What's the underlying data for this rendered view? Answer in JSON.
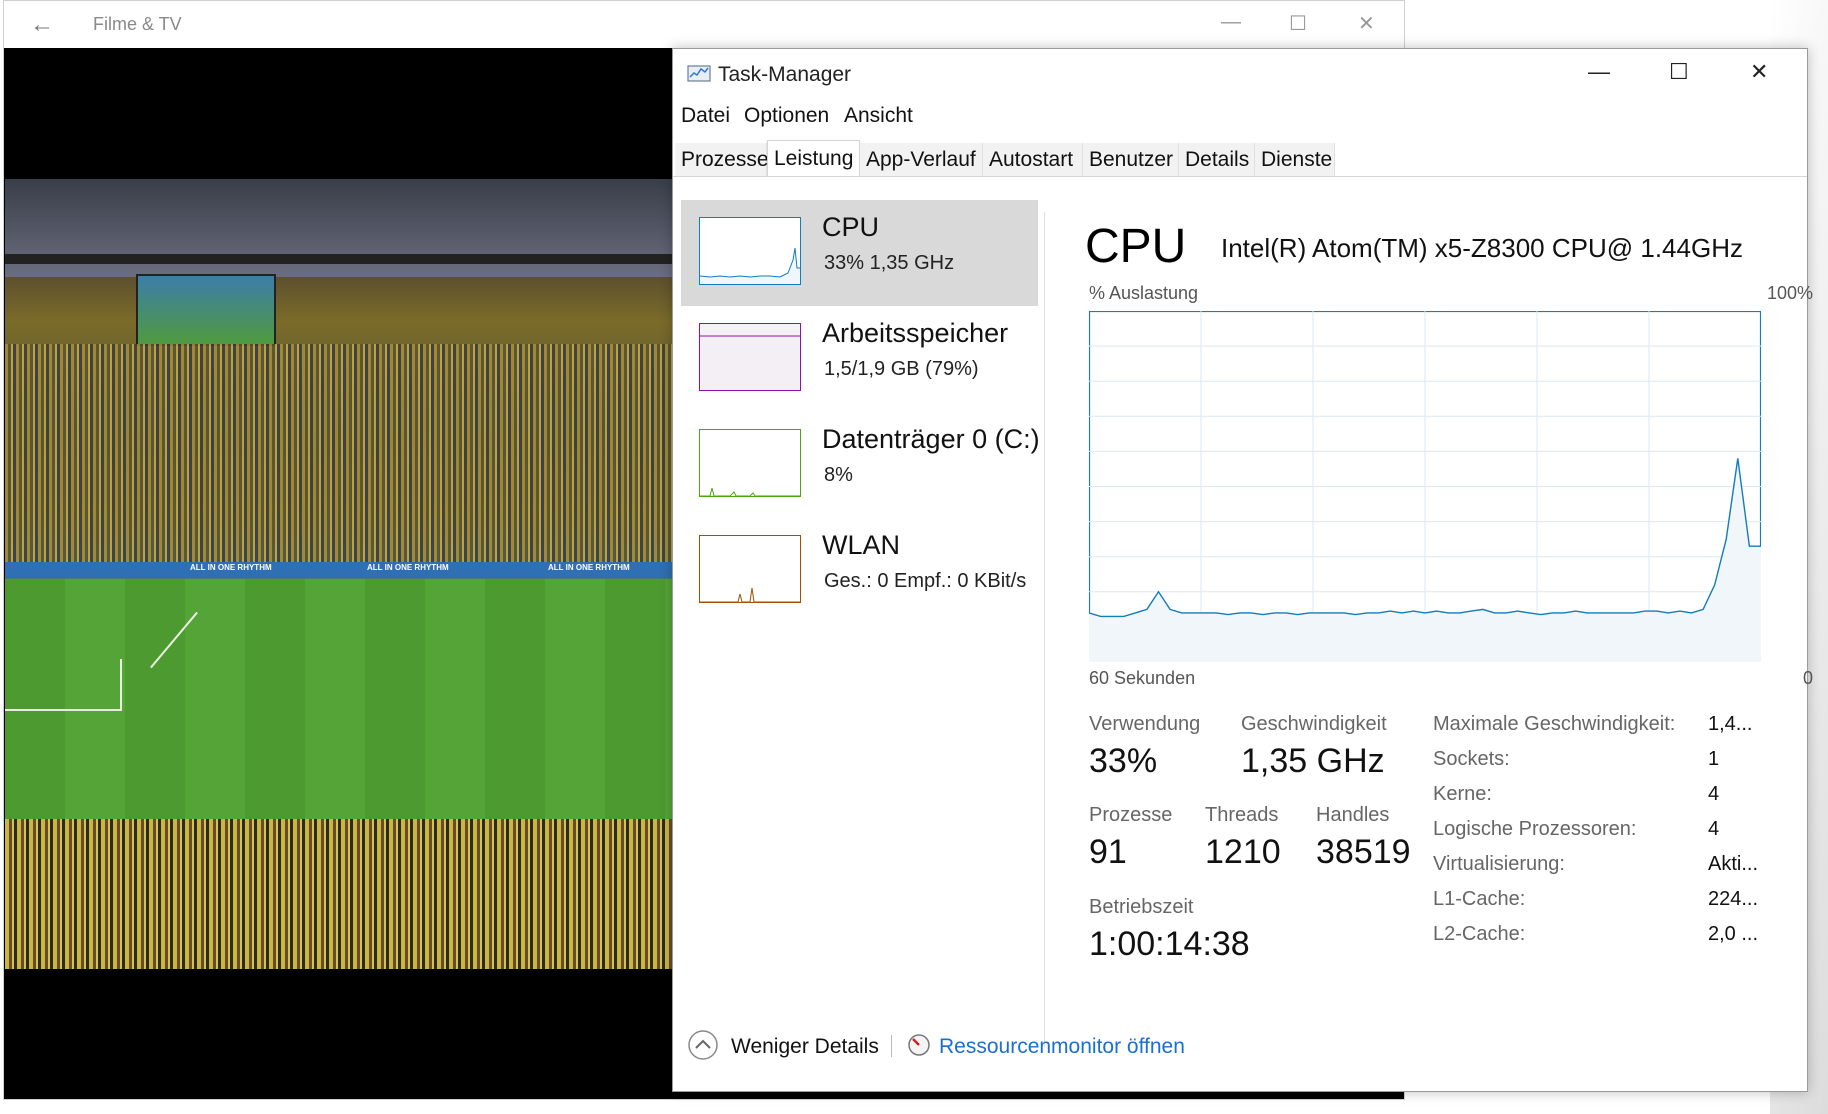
{
  "movies_window": {
    "title": "Filme & TV",
    "back_glyph": "←",
    "minimize_glyph": "—",
    "maximize_glyph": "☐",
    "close_glyph": "✕",
    "banner_text": "ALL IN ONE RHYTHM"
  },
  "task_manager": {
    "title": "Task-Manager",
    "window_controls": {
      "minimize": "—",
      "maximize": "☐",
      "close": "✕"
    },
    "menu": [
      "Datei",
      "Optionen",
      "Ansicht"
    ],
    "tabs": [
      "Prozesse",
      "Leistung",
      "App-Verlauf",
      "Autostart",
      "Benutzer",
      "Details",
      "Dienste"
    ],
    "active_tab": "Leistung",
    "sidebar": [
      {
        "name": "CPU",
        "sub": "33%  1,35 GHz",
        "color": "#117dbb",
        "selected": true
      },
      {
        "name": "Arbeitsspeicher",
        "sub": "1,5/1,9 GB (79%)",
        "color": "#8b12ae",
        "selected": false
      },
      {
        "name": "Datenträger 0 (C:)",
        "sub": "8%",
        "color": "#4da60c",
        "selected": false
      },
      {
        "name": "WLAN",
        "sub": "Ges.: 0  Empf.: 0 KBit/s",
        "color": "#a74f01",
        "selected": false
      }
    ],
    "detail": {
      "heading": "CPU",
      "model": "Intel(R) Atom(TM) x5-Z8300 CPU@ 1.44GHz",
      "graph_top_left": "% Auslastung",
      "graph_top_right": "100%",
      "graph_bottom_left": "60 Sekunden",
      "graph_bottom_right": "0",
      "stats": {
        "usage_label": "Verwendung",
        "usage_value": "33%",
        "speed_label": "Geschwindigkeit",
        "speed_value": "1,35 GHz",
        "processes_label": "Prozesse",
        "processes_value": "91",
        "threads_label": "Threads",
        "threads_value": "1210",
        "handles_label": "Handles",
        "handles_value": "38519",
        "uptime_label": "Betriebszeit",
        "uptime_value": "1:00:14:38"
      },
      "specs": [
        {
          "label": "Maximale Geschwindigkeit:",
          "value": "1,4..."
        },
        {
          "label": "Sockets:",
          "value": "1"
        },
        {
          "label": "Kerne:",
          "value": "4"
        },
        {
          "label": "Logische Prozessoren:",
          "value": "4"
        },
        {
          "label": "Virtualisierung:",
          "value": "Akti..."
        },
        {
          "label": "L1-Cache:",
          "value": "224..."
        },
        {
          "label": "L2-Cache:",
          "value": "2,0 ..."
        }
      ]
    },
    "footer": {
      "less_details": "Weniger Details",
      "resource_monitor": "Ressourcenmonitor öffnen"
    },
    "cpu_history_percent": [
      14,
      13,
      13,
      13,
      14,
      15,
      20,
      15,
      14,
      14,
      14,
      14,
      13.5,
      14,
      14,
      13.5,
      14,
      14,
      13.5,
      14,
      14,
      14,
      14,
      13.5,
      14,
      14,
      14.5,
      14,
      14.5,
      14,
      14.5,
      14,
      14,
      14.5,
      15,
      14,
      14,
      14.5,
      14,
      13.5,
      14,
      14,
      14.5,
      14,
      14,
      14,
      14,
      14,
      14.5,
      14.5,
      14,
      14.5,
      14,
      15,
      22,
      35,
      58,
      33,
      33
    ],
    "accent_color": "#117dbb"
  }
}
